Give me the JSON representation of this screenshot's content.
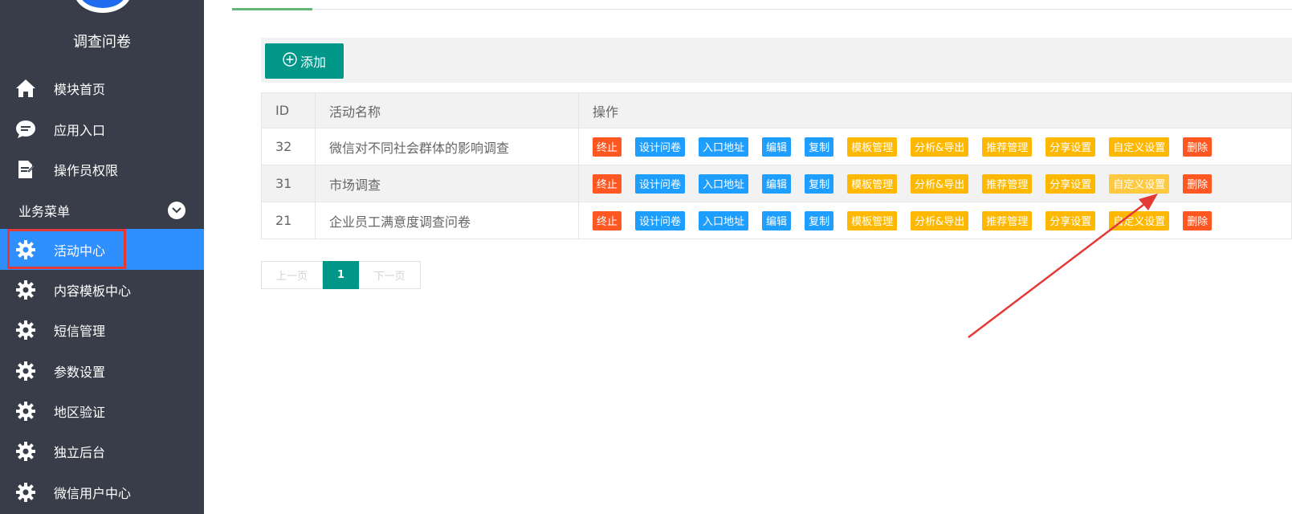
{
  "app": {
    "title": "调查问卷"
  },
  "sidebar": {
    "items": [
      {
        "label": "模块首页",
        "icon": "home-icon"
      },
      {
        "label": "应用入口",
        "icon": "chat-icon"
      },
      {
        "label": "操作员权限",
        "icon": "document-icon"
      }
    ],
    "group": {
      "label": "业务菜单"
    },
    "group_items": [
      {
        "label": "活动中心",
        "icon": "gear-icon",
        "active": true
      },
      {
        "label": "内容模板中心",
        "icon": "gear-icon"
      },
      {
        "label": "短信管理",
        "icon": "gear-icon"
      },
      {
        "label": "参数设置",
        "icon": "gear-icon"
      },
      {
        "label": "地区验证",
        "icon": "gear-icon"
      },
      {
        "label": "独立后台",
        "icon": "gear-icon"
      },
      {
        "label": "微信用户中心",
        "icon": "gear-icon"
      }
    ]
  },
  "toolbar": {
    "add_label": "添加"
  },
  "table": {
    "headers": {
      "id": "ID",
      "name": "活动名称",
      "ops": "操作"
    },
    "rows": [
      {
        "id": "32",
        "name": "微信对不同社会群体的影响调查"
      },
      {
        "id": "31",
        "name": "市场调查"
      },
      {
        "id": "21",
        "name": "企业员工满意度调查问卷"
      }
    ],
    "actions": [
      "终止",
      "设计问卷",
      "入口地址",
      "编辑",
      "复制",
      "模板管理",
      "分析&导出",
      "推荐管理",
      "分享设置",
      "自定义设置",
      "删除"
    ]
  },
  "pagination": {
    "prev": "上一页",
    "current": "1",
    "next": "下一页"
  },
  "colors": {
    "sidebar_bg": "#393D49",
    "active_bg": "#2F8FFF",
    "primary": "#009688",
    "danger": "#FF5722",
    "normal": "#1E9FFF",
    "warm": "#FFB800",
    "annotation": "#E53935"
  }
}
